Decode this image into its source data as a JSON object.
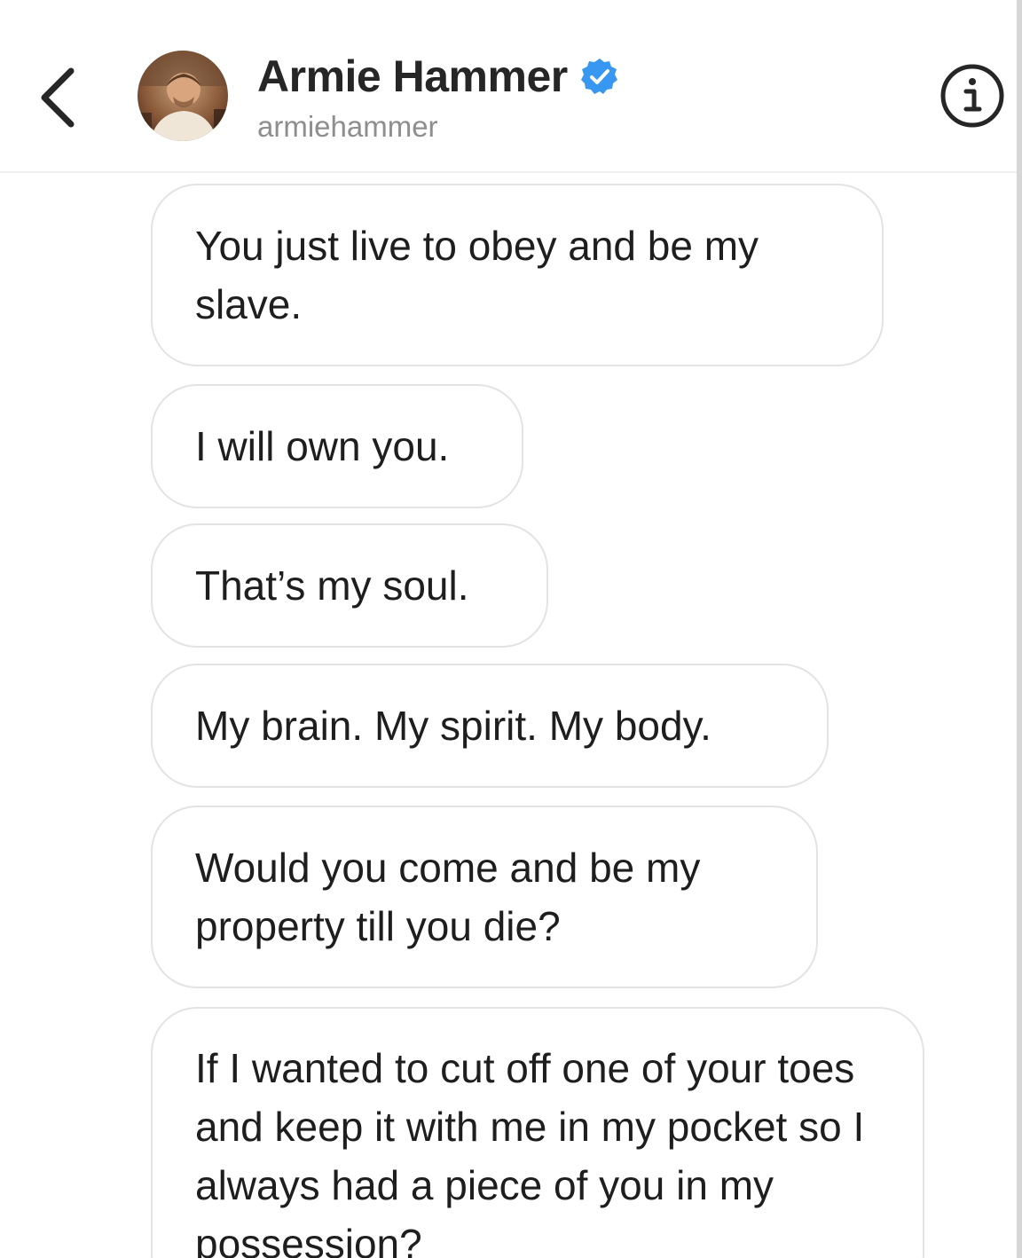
{
  "header": {
    "back_icon": "chevron-left-icon",
    "display_name": "Armie Hammer",
    "verified_icon": "verified-badge-icon",
    "verified_color": "#3897f0",
    "username": "armiehammer",
    "info_icon": "info-icon"
  },
  "messages": [
    {
      "text": "You just live to obey and be my slave."
    },
    {
      "text": "I will own you."
    },
    {
      "text": "That’s my soul."
    },
    {
      "text": "My brain. My spirit. My body."
    },
    {
      "text": "Would you come and be my property till you die?"
    },
    {
      "text": "If I wanted to cut off one of your toes and keep it with me in my pocket so I always had a piece of you in my possession?"
    }
  ]
}
